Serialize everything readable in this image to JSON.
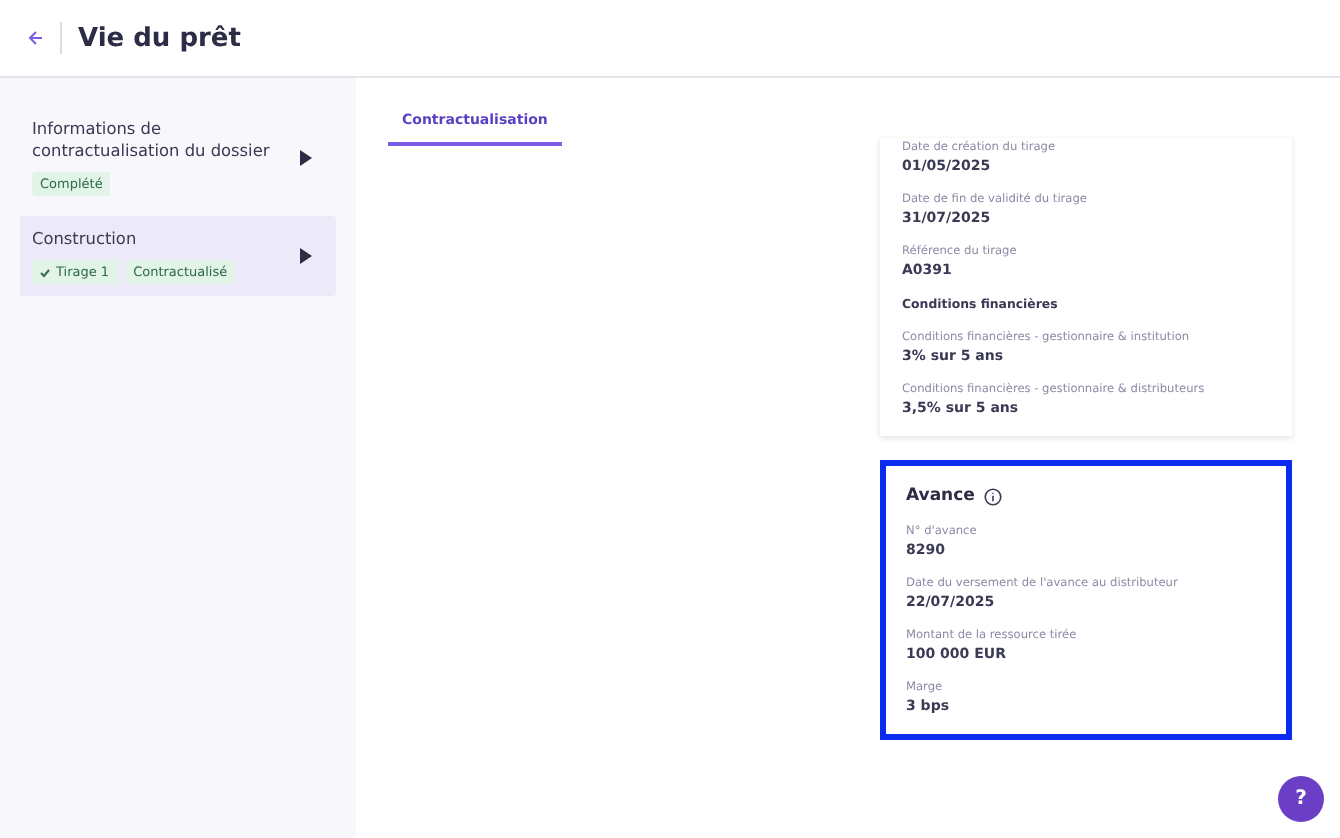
{
  "header": {
    "title": "Vie du prêt"
  },
  "sidebar": {
    "items": [
      {
        "title": "Informations de contractualisation du dossier",
        "selected": false,
        "tags": [
          {
            "label": "Complété",
            "check": false
          }
        ]
      },
      {
        "title": "Construction",
        "selected": true,
        "tags": [
          {
            "label": "Tirage 1",
            "check": true
          },
          {
            "label": "Contractualisé",
            "check": false
          }
        ]
      }
    ]
  },
  "tabs": [
    {
      "label": "Contractualisation",
      "selected": true
    }
  ],
  "cards": [
    {
      "highlighted": false,
      "fields": [
        {
          "kind": "field",
          "label": "Date de création du tirage",
          "value": "01/05/2025"
        },
        {
          "kind": "field",
          "label": "Date de fin de validité du tirage",
          "value": "31/07/2025"
        },
        {
          "kind": "field",
          "label": "Référence du tirage",
          "value": "A0391"
        },
        {
          "kind": "section",
          "label": "Conditions financières"
        },
        {
          "kind": "field",
          "label": "Conditions financières - gestionnaire & institution",
          "value": "3% sur 5 ans"
        },
        {
          "kind": "field",
          "label": "Conditions financières - gestionnaire & distributeurs",
          "value": "3,5% sur 5 ans"
        }
      ]
    },
    {
      "title": "Avance",
      "highlighted": true,
      "fields": [
        {
          "kind": "field",
          "label": "N° d'avance",
          "value": "8290"
        },
        {
          "kind": "field",
          "label": "Date du versement de l'avance au distributeur",
          "value": "22/07/2025"
        },
        {
          "kind": "field",
          "label": "Montant de la ressource tirée",
          "value": "100 000 EUR"
        },
        {
          "kind": "field",
          "label": "Marge",
          "value": "3 bps"
        }
      ]
    }
  ],
  "help_button": {
    "label": "?"
  }
}
